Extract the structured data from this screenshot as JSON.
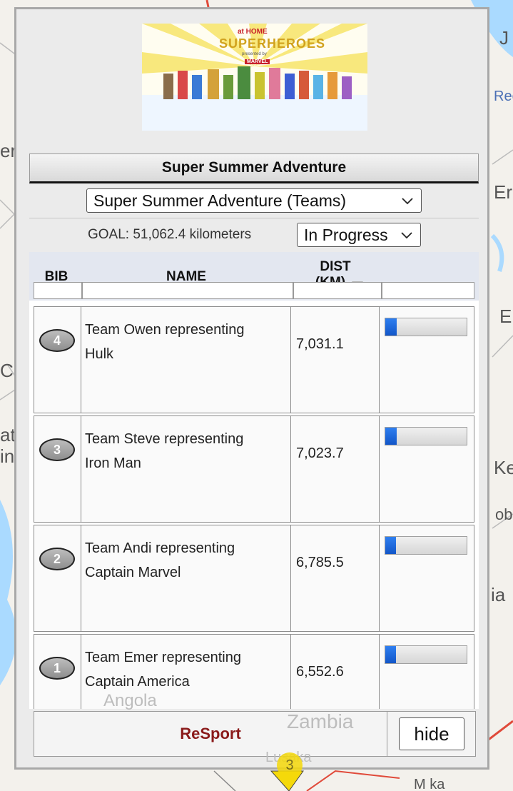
{
  "map": {
    "labels": {
      "j": "J",
      "rec": "Rec",
      "er_left": "er",
      "er_right": "Er",
      "e_right": "E",
      "c_left": "C",
      "at_left": "at",
      "in_left": "in",
      "ken": "Ker",
      "obi": "ob",
      "ia": "ia",
      "angola": "Angola",
      "zambia": "Zambia",
      "lusaka": "Lusaka",
      "marker": "3",
      "bottom_right": "M  ka"
    }
  },
  "panel": {
    "logo": {
      "brand": "at HOME",
      "title": "SUPERHEROES",
      "subtitle": "presented by",
      "badge": "MARVEL"
    },
    "title": "Super Summer Adventure",
    "event_select": {
      "value": "Super Summer Adventure (Teams)"
    },
    "goal": "GOAL: 51,062.4 kilometers",
    "status_select": {
      "value": "In Progress"
    },
    "table": {
      "headers": {
        "bib": "BIB",
        "name": "NAME",
        "dist_line1": "DIST",
        "dist_line2": "(KM)"
      },
      "rows": [
        {
          "bib": "4",
          "name_line1": "Team Owen representing",
          "name_line2": "Hulk",
          "dist": "7,031.1",
          "progress": 0.14
        },
        {
          "bib": "3",
          "name_line1": "Team Steve representing",
          "name_line2": "Iron Man",
          "dist": "7,023.7",
          "progress": 0.14
        },
        {
          "bib": "2",
          "name_line1": "Team Andi representing",
          "name_line2": "Captain Marvel",
          "dist": "6,785.5",
          "progress": 0.13
        },
        {
          "bib": "1",
          "name_line1": "Team Emer representing",
          "name_line2": "Captain America",
          "dist": "6,552.6",
          "progress": 0.13
        }
      ]
    },
    "footer": {
      "resport": "ReSport",
      "hide": "hide"
    }
  },
  "colors": {
    "bar_fill": "#1f6ee0",
    "resport": "#8a1a1a",
    "marker": "#f5d90a",
    "road": "#e04a3a"
  }
}
